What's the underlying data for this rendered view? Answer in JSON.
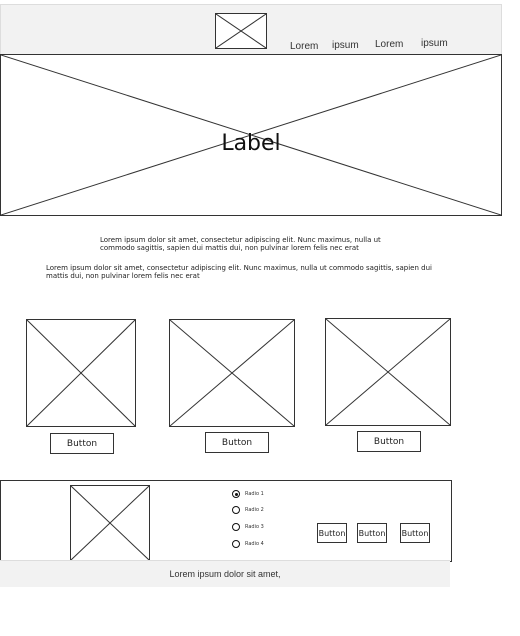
{
  "nav": {
    "items": [
      {
        "label": "Lorem"
      },
      {
        "label": "ipsum"
      },
      {
        "label": "Lorem"
      },
      {
        "label": "ipsum"
      }
    ]
  },
  "hero": {
    "label": "Label"
  },
  "paragraphs": [
    "Lorem ipsum dolor sit amet, consectetur adipiscing elit. Nunc maximus, nulla ut commodo sagittis, sapien dui mattis dui, non pulvinar lorem felis nec erat",
    "Lorem ipsum dolor sit amet, consectetur adipiscing elit. Nunc maximus, nulla ut commodo sagittis, sapien dui mattis dui, non pulvinar lorem felis nec erat"
  ],
  "cards": [
    {
      "button_label": "Button"
    },
    {
      "button_label": "Button"
    },
    {
      "button_label": "Button"
    }
  ],
  "panel": {
    "radios": [
      {
        "label": "Radio 1",
        "selected": true
      },
      {
        "label": "Radio 2",
        "selected": false
      },
      {
        "label": "Radio 3",
        "selected": false
      },
      {
        "label": "Radio 4",
        "selected": false
      }
    ],
    "buttons": [
      {
        "label": "Button"
      },
      {
        "label": "Button"
      },
      {
        "label": "Button"
      }
    ]
  },
  "footer": {
    "text": "Lorem ipsum dolor sit amet,"
  }
}
